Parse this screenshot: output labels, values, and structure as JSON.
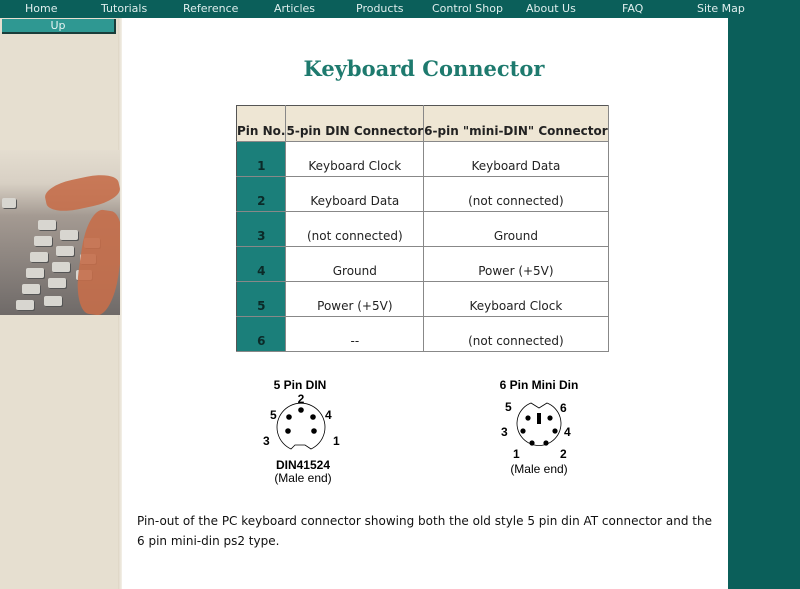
{
  "nav": {
    "items": [
      {
        "label": "Home"
      },
      {
        "label": "Tutorials"
      },
      {
        "label": "Reference"
      },
      {
        "label": "Articles"
      },
      {
        "label": "Products"
      },
      {
        "label": "Control Shop"
      },
      {
        "label": "About Us"
      },
      {
        "label": "FAQ"
      },
      {
        "label": "Site Map"
      }
    ],
    "up_label": "Up"
  },
  "page": {
    "title": "Keyboard Connector",
    "caption": "Pin-out of the PC keyboard connector showing both the old style 5 pin din AT connector and the 6 pin mini-din ps2 type."
  },
  "table": {
    "headers": [
      "Pin No.",
      "5-pin DIN Connector",
      "6-pin \"mini-DIN\" Connector"
    ],
    "rows": [
      {
        "pin": "1",
        "din5": "Keyboard Clock",
        "mini6": "Keyboard Data"
      },
      {
        "pin": "2",
        "din5": "Keyboard Data",
        "mini6": "(not connected)"
      },
      {
        "pin": "3",
        "din5": "(not connected)",
        "mini6": "Ground"
      },
      {
        "pin": "4",
        "din5": "Ground",
        "mini6": "Power (+5V)"
      },
      {
        "pin": "5",
        "din5": "Power (+5V)",
        "mini6": "Keyboard Clock"
      },
      {
        "pin": "6",
        "din5": "--",
        "mini6": "(not connected)"
      }
    ]
  },
  "diagrams": {
    "din5": {
      "title": "5 Pin DIN",
      "pins": [
        "1",
        "2",
        "3",
        "4",
        "5"
      ],
      "standard": "DIN41524",
      "note": "(Male end)"
    },
    "mini6": {
      "title": "6 Pin Mini Din",
      "pins": [
        "1",
        "2",
        "3",
        "4",
        "5",
        "6"
      ],
      "note": "(Male end)"
    }
  },
  "colors": {
    "nav_bg": "#0b5f5a",
    "accent": "#1b7f7a",
    "title": "#1e7a6e",
    "sidebar": "#e6dfd0",
    "table_header": "#eee6d4"
  }
}
